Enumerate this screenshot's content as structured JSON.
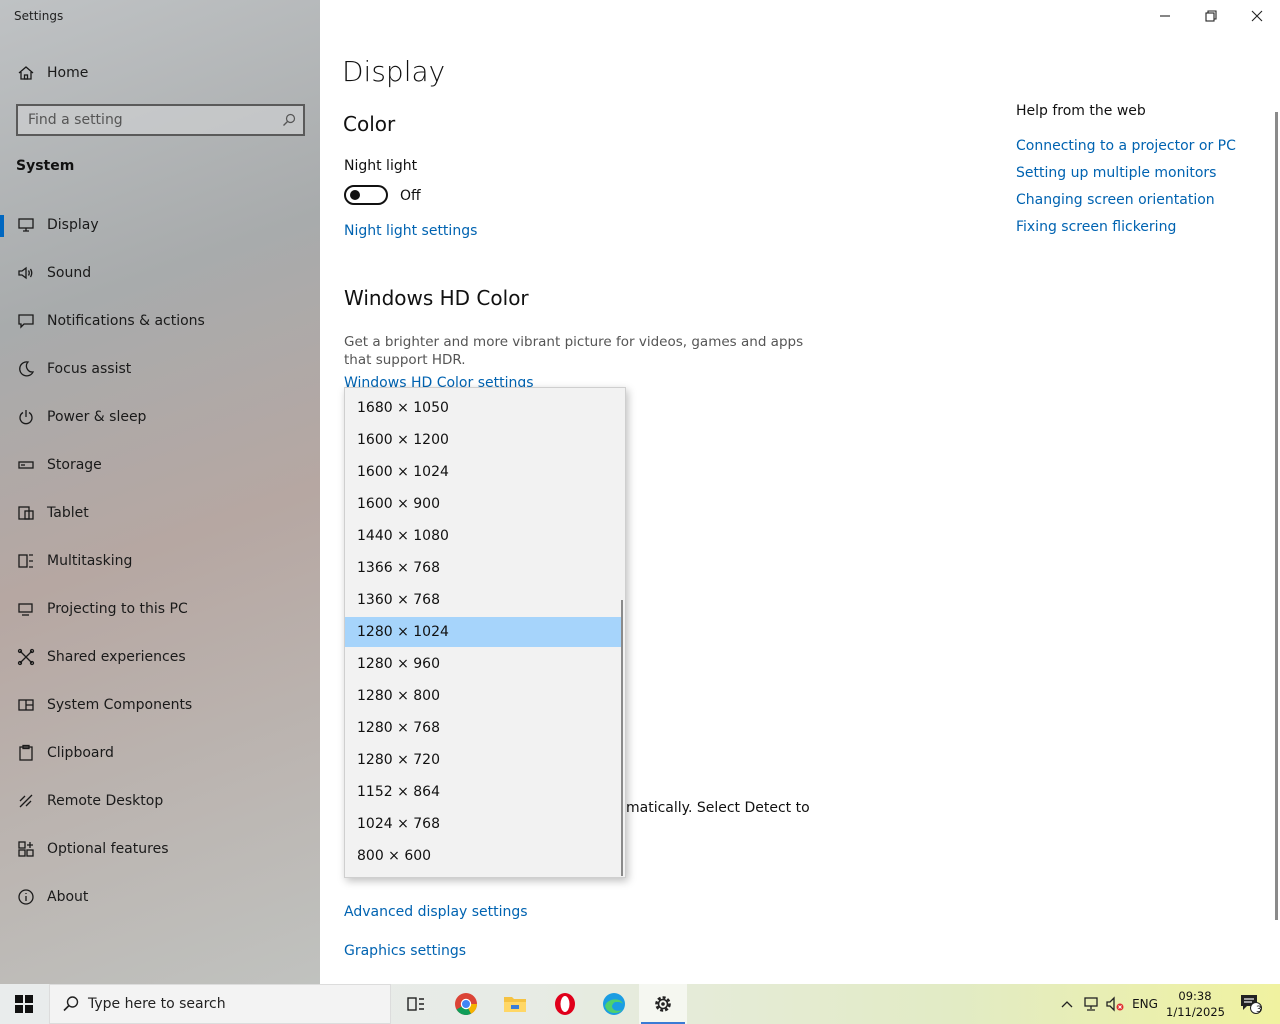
{
  "window": {
    "title": "Settings"
  },
  "sidebar": {
    "home": "Home",
    "search_placeholder": "Find a setting",
    "section": "System",
    "items": [
      {
        "label": "Display",
        "icon": "monitor-icon",
        "selected": true
      },
      {
        "label": "Sound",
        "icon": "speaker-icon"
      },
      {
        "label": "Notifications & actions",
        "icon": "notification-icon"
      },
      {
        "label": "Focus assist",
        "icon": "moon-icon"
      },
      {
        "label": "Power & sleep",
        "icon": "power-icon"
      },
      {
        "label": "Storage",
        "icon": "storage-icon"
      },
      {
        "label": "Tablet",
        "icon": "tablet-icon"
      },
      {
        "label": "Multitasking",
        "icon": "multitasking-icon"
      },
      {
        "label": "Projecting to this PC",
        "icon": "projector-icon"
      },
      {
        "label": "Shared experiences",
        "icon": "shared-icon"
      },
      {
        "label": "System Components",
        "icon": "components-icon"
      },
      {
        "label": "Clipboard",
        "icon": "clipboard-icon"
      },
      {
        "label": "Remote Desktop",
        "icon": "remote-desktop-icon"
      },
      {
        "label": "Optional features",
        "icon": "grid-plus-icon"
      },
      {
        "label": "About",
        "icon": "info-icon"
      }
    ]
  },
  "main": {
    "title": "Display",
    "color_heading": "Color",
    "night_light_label": "Night light",
    "night_light_state": "Off",
    "night_light_link": "Night light settings",
    "hdr_heading": "Windows HD Color",
    "hdr_description": "Get a brighter and more vibrant picture for videos, games and apps that support HDR.",
    "hdr_link": "Windows HD Color settings",
    "partial_text": "matically. Select Detect to",
    "advanced_link": "Advanced display settings",
    "graphics_link": "Graphics settings"
  },
  "help": {
    "heading": "Help from the web",
    "links": [
      "Connecting to a projector or PC",
      "Setting up multiple monitors",
      "Changing screen orientation",
      "Fixing screen flickering"
    ]
  },
  "resolution_dropdown": {
    "selected": "1280 × 1024",
    "options": [
      "1680 × 1050",
      "1600 × 1200",
      "1600 × 1024",
      "1600 × 900",
      "1440 × 1080",
      "1366 × 768",
      "1360 × 768",
      "1280 × 1024",
      "1280 × 960",
      "1280 × 800",
      "1280 × 768",
      "1280 × 720",
      "1152 × 864",
      "1024 × 768",
      "800 × 600"
    ]
  },
  "taskbar": {
    "search_placeholder": "Type here to search",
    "apps": [
      "task-view-icon",
      "chrome-icon",
      "file-explorer-icon",
      "opera-icon",
      "edge-icon",
      "settings-gear-icon"
    ],
    "language": "ENG",
    "time": "09:38",
    "date": "1/11/2025",
    "notification_count": "3"
  },
  "colors": {
    "accent": "#0067c0",
    "link": "#0063b1",
    "selected_item": "#a6d4fb"
  }
}
